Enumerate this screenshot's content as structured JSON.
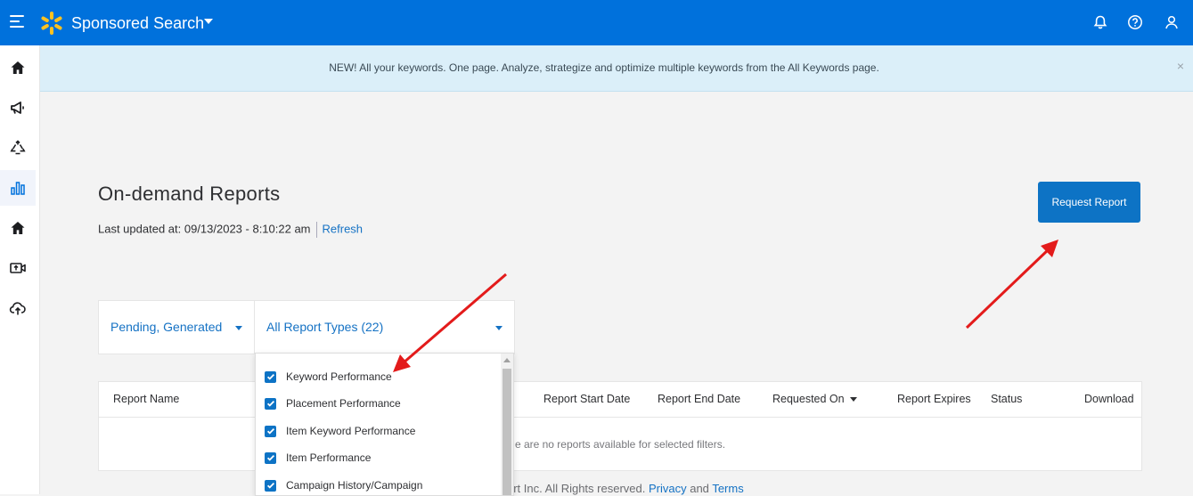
{
  "header": {
    "app_title": "Sponsored Search",
    "colors": {
      "brand_blue": "#0071dc",
      "spark_yellow": "#ffc220",
      "link_blue": "#1572c4"
    },
    "icons": [
      "menu-icon",
      "spark-logo-icon",
      "bell-icon",
      "help-icon",
      "user-icon"
    ]
  },
  "sidebar": {
    "items": [
      {
        "icon": "home-icon"
      },
      {
        "icon": "megaphone-icon"
      },
      {
        "icon": "recycle-icon"
      },
      {
        "icon": "bar-chart-icon",
        "active": true
      },
      {
        "icon": "home-alt-icon"
      },
      {
        "icon": "video-upload-icon"
      },
      {
        "icon": "cloud-upload-icon"
      }
    ]
  },
  "banner": {
    "text": "NEW! All your keywords. One page. Analyze, strategize and optimize multiple keywords from the All Keywords page.",
    "close": "×"
  },
  "page": {
    "title": "On-demand Reports",
    "last_updated": "Last updated at: 09/13/2023 - 8:10:22 am",
    "refresh": "Refresh",
    "request_button": "Request Report"
  },
  "filters": {
    "status": "Pending, Generated",
    "report_types": "All Report Types (22)"
  },
  "dropdown": {
    "options": [
      {
        "label": "Keyword Performance",
        "checked": true
      },
      {
        "label": "Placement Performance",
        "checked": true
      },
      {
        "label": "Item Keyword Performance",
        "checked": true
      },
      {
        "label": "Item Performance",
        "checked": true
      },
      {
        "label": "Campaign History/Campaign",
        "checked": true
      }
    ]
  },
  "table": {
    "columns": [
      "Report Name",
      "Report Start Date",
      "Report End Date",
      "Requested On",
      "Report Expires",
      "Status",
      "Download"
    ],
    "empty_message": "e are no reports available for selected filters."
  },
  "footer": {
    "copyright": "lmart Inc. All Rights reserved.",
    "privacy": "Privacy",
    "and": "and",
    "terms": "Terms"
  }
}
